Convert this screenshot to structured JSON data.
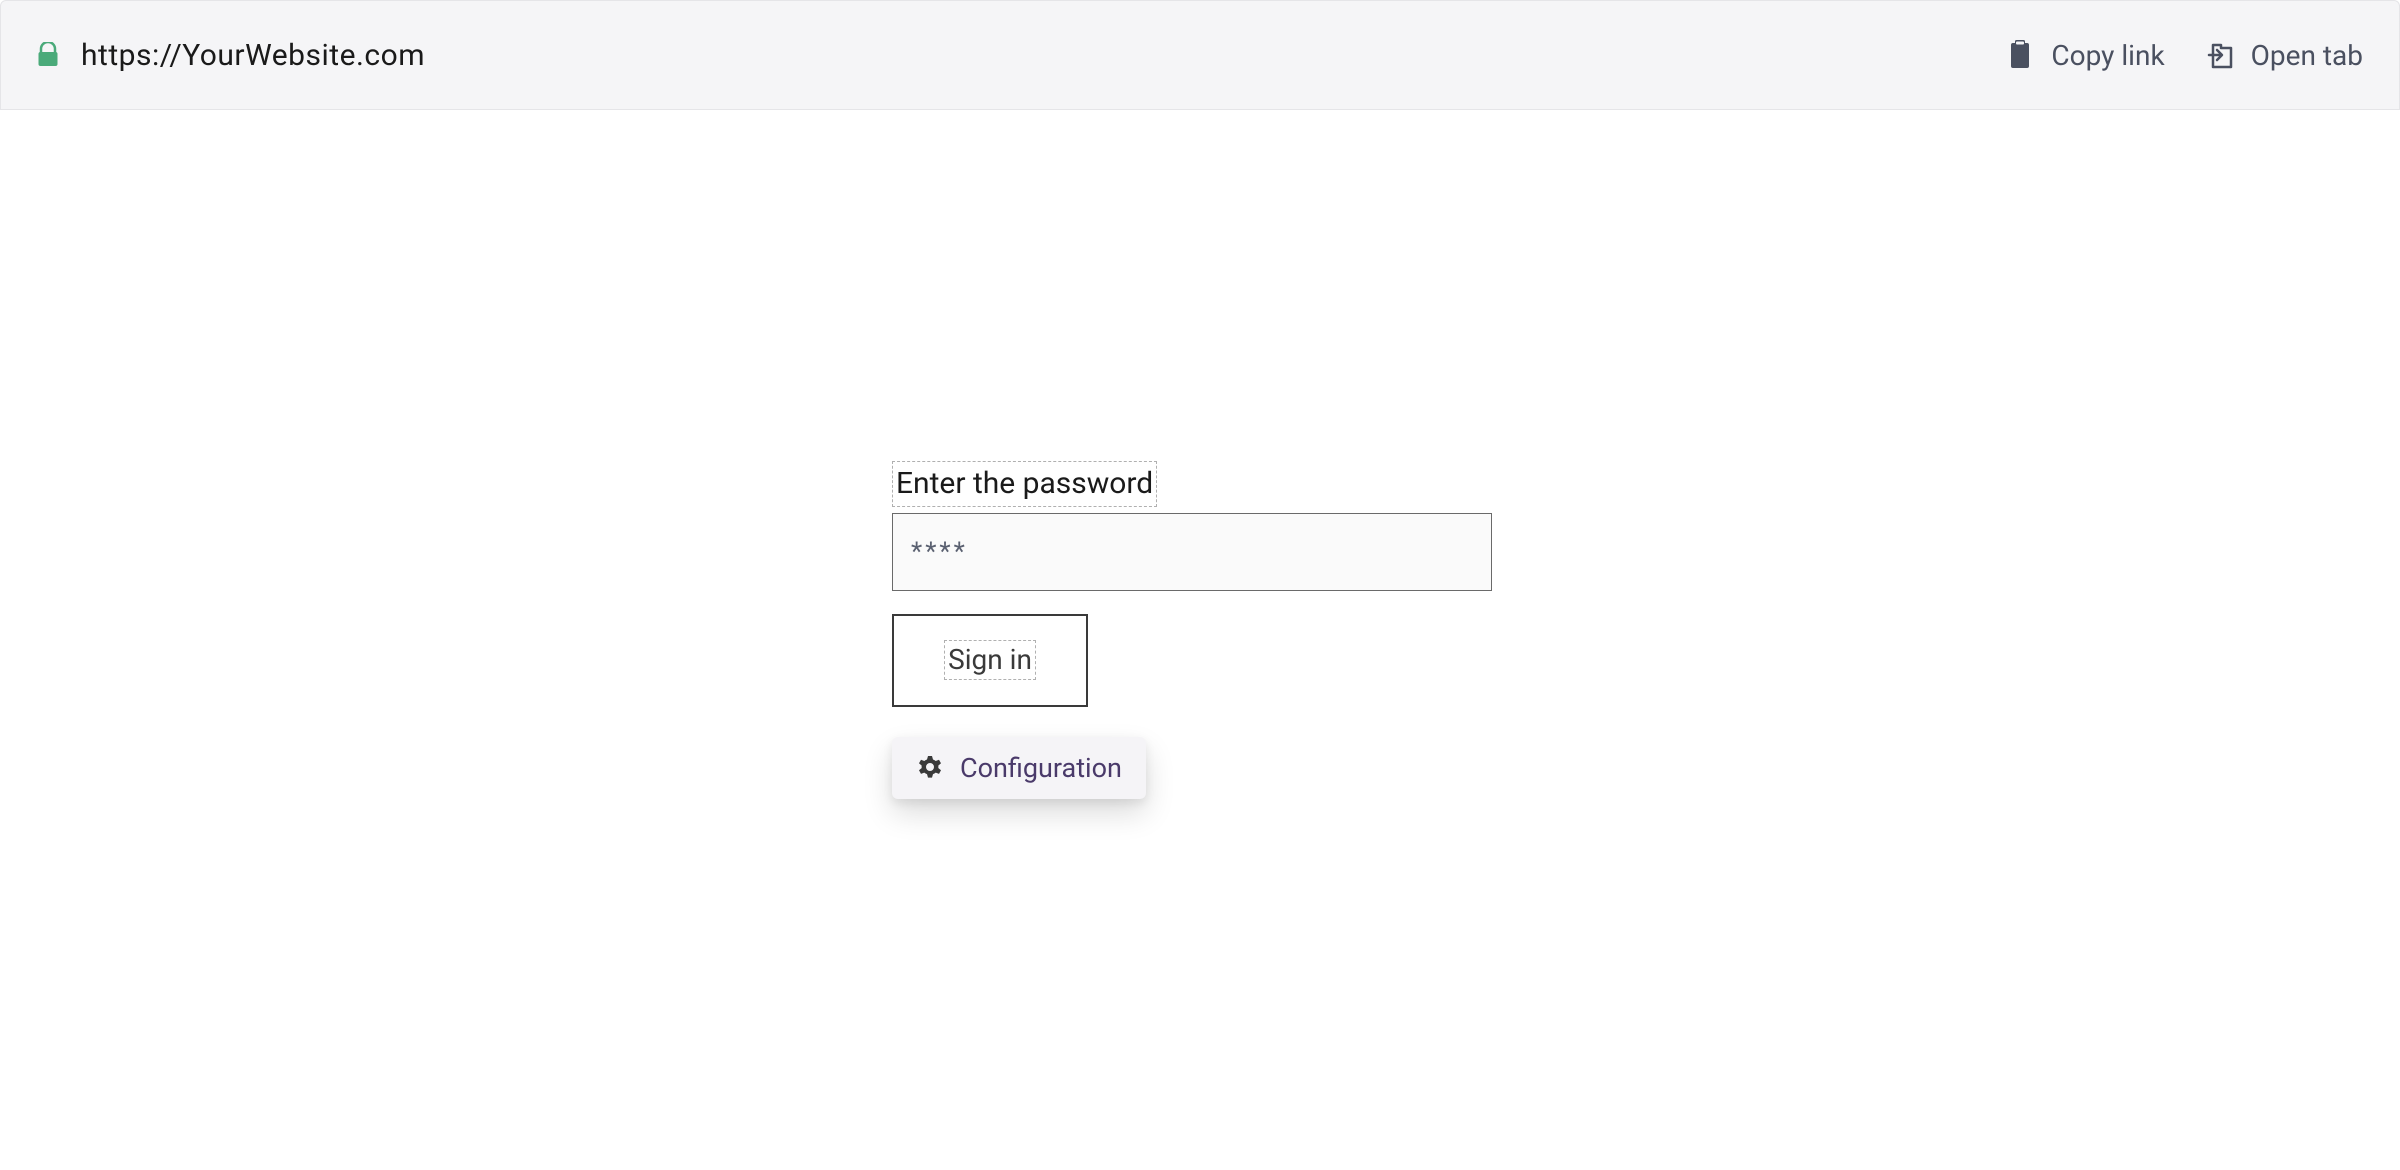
{
  "addressBar": {
    "url": "https://YourWebsite.com",
    "copyLinkLabel": "Copy link",
    "openTabLabel": "Open tab"
  },
  "form": {
    "passwordLabel": "Enter the password",
    "passwordPlaceholder": "****",
    "signInLabel": "Sign in",
    "configurationLabel": "Configuration"
  }
}
